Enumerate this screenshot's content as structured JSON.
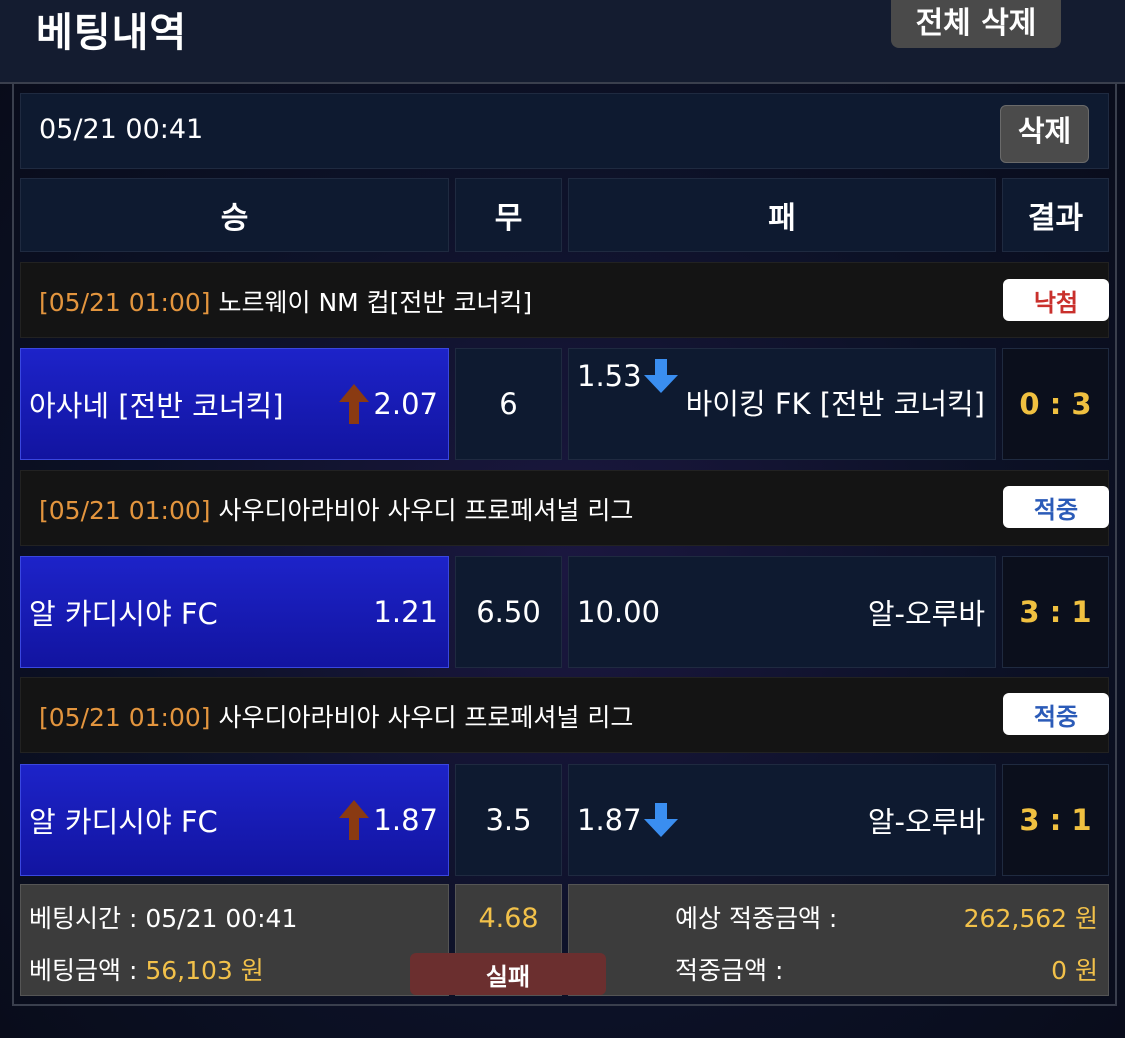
{
  "header": {
    "title": "베팅내역",
    "delete_all": "전체 삭제"
  },
  "bet": {
    "time": "05/21 00:41",
    "delete_label": "삭제",
    "columns": {
      "win": "승",
      "draw": "무",
      "lose": "패",
      "result": "결과"
    },
    "matches": [
      {
        "league_time": "[05/21 01:00]",
        "league": "노르웨이 NM 컵[전반 코너킥]",
        "status": "낙첨",
        "home": "아사네 [전반 코너킥]",
        "home_odds": "2.07",
        "home_icon": "arrow-up-icon",
        "draw": "6",
        "away_odds": "1.53",
        "away_icon": "arrow-down-icon",
        "away": "바이킹 FK [전반 코너킥]",
        "score": "0 : 3"
      },
      {
        "league_time": "[05/21 01:00]",
        "league": "사우디아라비아 사우디 프로페셔널 리그",
        "status": "적중",
        "home": "알 카디시야 FC",
        "home_odds": "1.21",
        "draw": "6.50",
        "away_odds": "10.00",
        "away": "알-오루바",
        "score": "3 : 1"
      },
      {
        "league_time": "[05/21 01:00]",
        "league": "사우디아라비아 사우디 프로페셔널 리그",
        "status": "적중",
        "home": "알 카디시야 FC",
        "home_odds": "1.87",
        "home_icon": "arrow-up-icon",
        "draw": "3.5",
        "away_odds": "1.87",
        "away_icon": "arrow-down-icon",
        "away": "알-오루바",
        "score": "3 : 1"
      }
    ],
    "summary": {
      "bet_time_label": "베팅시간 :",
      "bet_time": "05/21 00:41",
      "bet_amount_label": "베팅금액 :",
      "bet_amount": "56,103 원",
      "total_odds": "4.68",
      "outcome": "실패",
      "expected_label": "예상 적중금액 :",
      "expected_amount": "262,562 원",
      "won_label": "적중금액 :",
      "won_amount": "0 원"
    }
  },
  "colors": {
    "home_bg": "#1a1fc0",
    "league_time": "#e3953e",
    "score": "#f0c040",
    "lose_badge": "#c9302c",
    "win_badge": "#2b5bb8",
    "outcome_bg": "#6b2f2f",
    "arrow_up": "#8a3a12",
    "arrow_down": "#3a8ef0"
  }
}
